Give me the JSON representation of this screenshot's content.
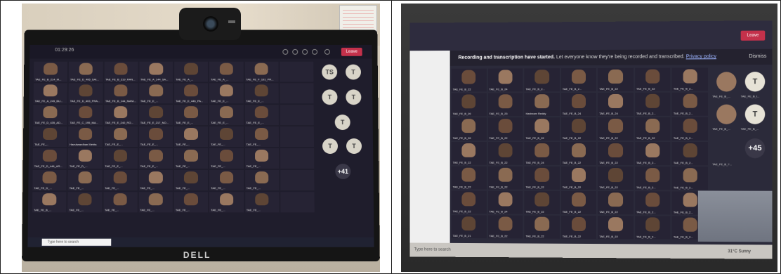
{
  "left_photo": {
    "timer": "01:29:26",
    "leave": "Leave",
    "search_placeholder": "Type here to search",
    "brand": "DELL",
    "avatars": [
      "TS",
      "T",
      "T",
      "T",
      "T",
      "T",
      "T",
      "+41"
    ],
    "tile_labels": [
      "TAE_FE_B_214_M...",
      "TAE_FE_D_406_SAI...",
      "TAE_FE_B_219_RAN...",
      "TAE_FE_A_144_SA...",
      "TAE_FE_A_...",
      "TAE_FE_A_...",
      "TAE_FE_F_191_PR...",
      "",
      "TAE_FE_A_249_BU...",
      "TAE_FE_D_403_PRA...",
      "TAE_FE_B_144_MANI...",
      "TAE_FE_E_...",
      "TAE_FE_E_446_PA...",
      "TAE_FE_E_...",
      "TAE_FE_E_...",
      "",
      "TAE_FE_D_435_AD...",
      "TAE_FE_C_195_MA...",
      "TAE_FE_E_240_RO...",
      "TAE_FE_E_217_NO...",
      "TAE_FE_E_...",
      "TAE_FE_E_...",
      "TAE_FE_E_...",
      "",
      "TAE_FE_...",
      "Harshwardhan Mehta",
      "TAE_FE_E_...",
      "TAE_FE_E_...",
      "TAE_FE_...",
      "TAE_FE_...",
      "TAE_FE_...",
      "",
      "TAE_FE_D_446_AR...",
      "TAE_FE_D_...",
      "TAE_FE_E_...",
      "TAE_FE_E_...",
      "TAE_FE_...",
      "TAE_FE_...",
      "TAE_FE_...",
      "",
      "TAE_FE_D_...",
      "TAE_FE_...",
      "TAE_FE_...",
      "TAE_FE_...",
      "TAE_FE_...",
      "TAE_FE_...",
      "TAE_FE_...",
      "",
      "TAE_FE_B_...",
      "TAE_FE_...",
      "TAE_FE_...",
      "TAE_FE_...",
      "TAE_FE_...",
      "TAE_FE_...",
      "TAE_FE_...",
      ""
    ]
  },
  "right_photo": {
    "leave": "Leave",
    "notice_bold": "Recording and transcription have started.",
    "notice_text": "Let everyone know they're being recorded and transcribed.",
    "notice_link": "Privacy policy",
    "dismiss": "Dismiss",
    "avatars": [
      "T",
      "T",
      "+45"
    ],
    "side_labels": [
      "TAE_FE_B_...",
      "TAE_FE_B_I...",
      "TAE_FE_B_...",
      "TAE_FE_B_...",
      "TAE_FE_B_?..."
    ],
    "named_tile": "Harinram Reddy",
    "tile_labels": [
      "TAE_FE_B_22",
      "TAE_FE_B_24",
      "TAE_FE_B_2...",
      "TAE_FE_B_2...",
      "TAE_FE_B_22",
      "TAE_FE_B_22",
      "TAE_FE_B_2...",
      "TAE_FE_B_20",
      "TAE_FE_B_23",
      "Harinram Reddy",
      "TAE_FE_B_24",
      "TAE_FE_B_24",
      "TAE_FE_B_2...",
      "TAE_FE_B_2...",
      "TAE_FE_B_20",
      "TAE_FE_B_22",
      "TAE_FE_B_22",
      "TAE_FE_B_22",
      "TAE_FE_B_22",
      "TAE_FE_B_22",
      "TAE_FE_B_2...",
      "TAE_FE_B_22",
      "TAE_FE_B_22",
      "TAE_FE_B_24",
      "TAE_FE_B_22",
      "TAE_FE_B_22",
      "TAE_FE_B_2...",
      "TAE_FE_B_2...",
      "TAE_FE_B_22",
      "TAE_FE_B_22",
      "TAE_FE_B_22",
      "TAE_FE_B_22",
      "TAE_FE_B_22",
      "TAE_FE_B_2...",
      "TAE_FE_B_2...",
      "TAE_FE_B_22",
      "TAE_FE_B_24",
      "TAE_FE_B_22",
      "TAE_FE_B_22",
      "TAE_FE_B_22",
      "TAE_FE_B_2...",
      "TAE_FE_B_2...",
      "TAE_FE_B_21",
      "TAE_FE_B_22",
      "TAE_FE_B_22",
      "TAE_FE_B_22",
      "TAE_FE_B_22",
      "TAE_FE_B_2...",
      "TAE_FE_B_2..."
    ],
    "search_placeholder": "Type here to search",
    "weather": "31°C Sunny"
  }
}
